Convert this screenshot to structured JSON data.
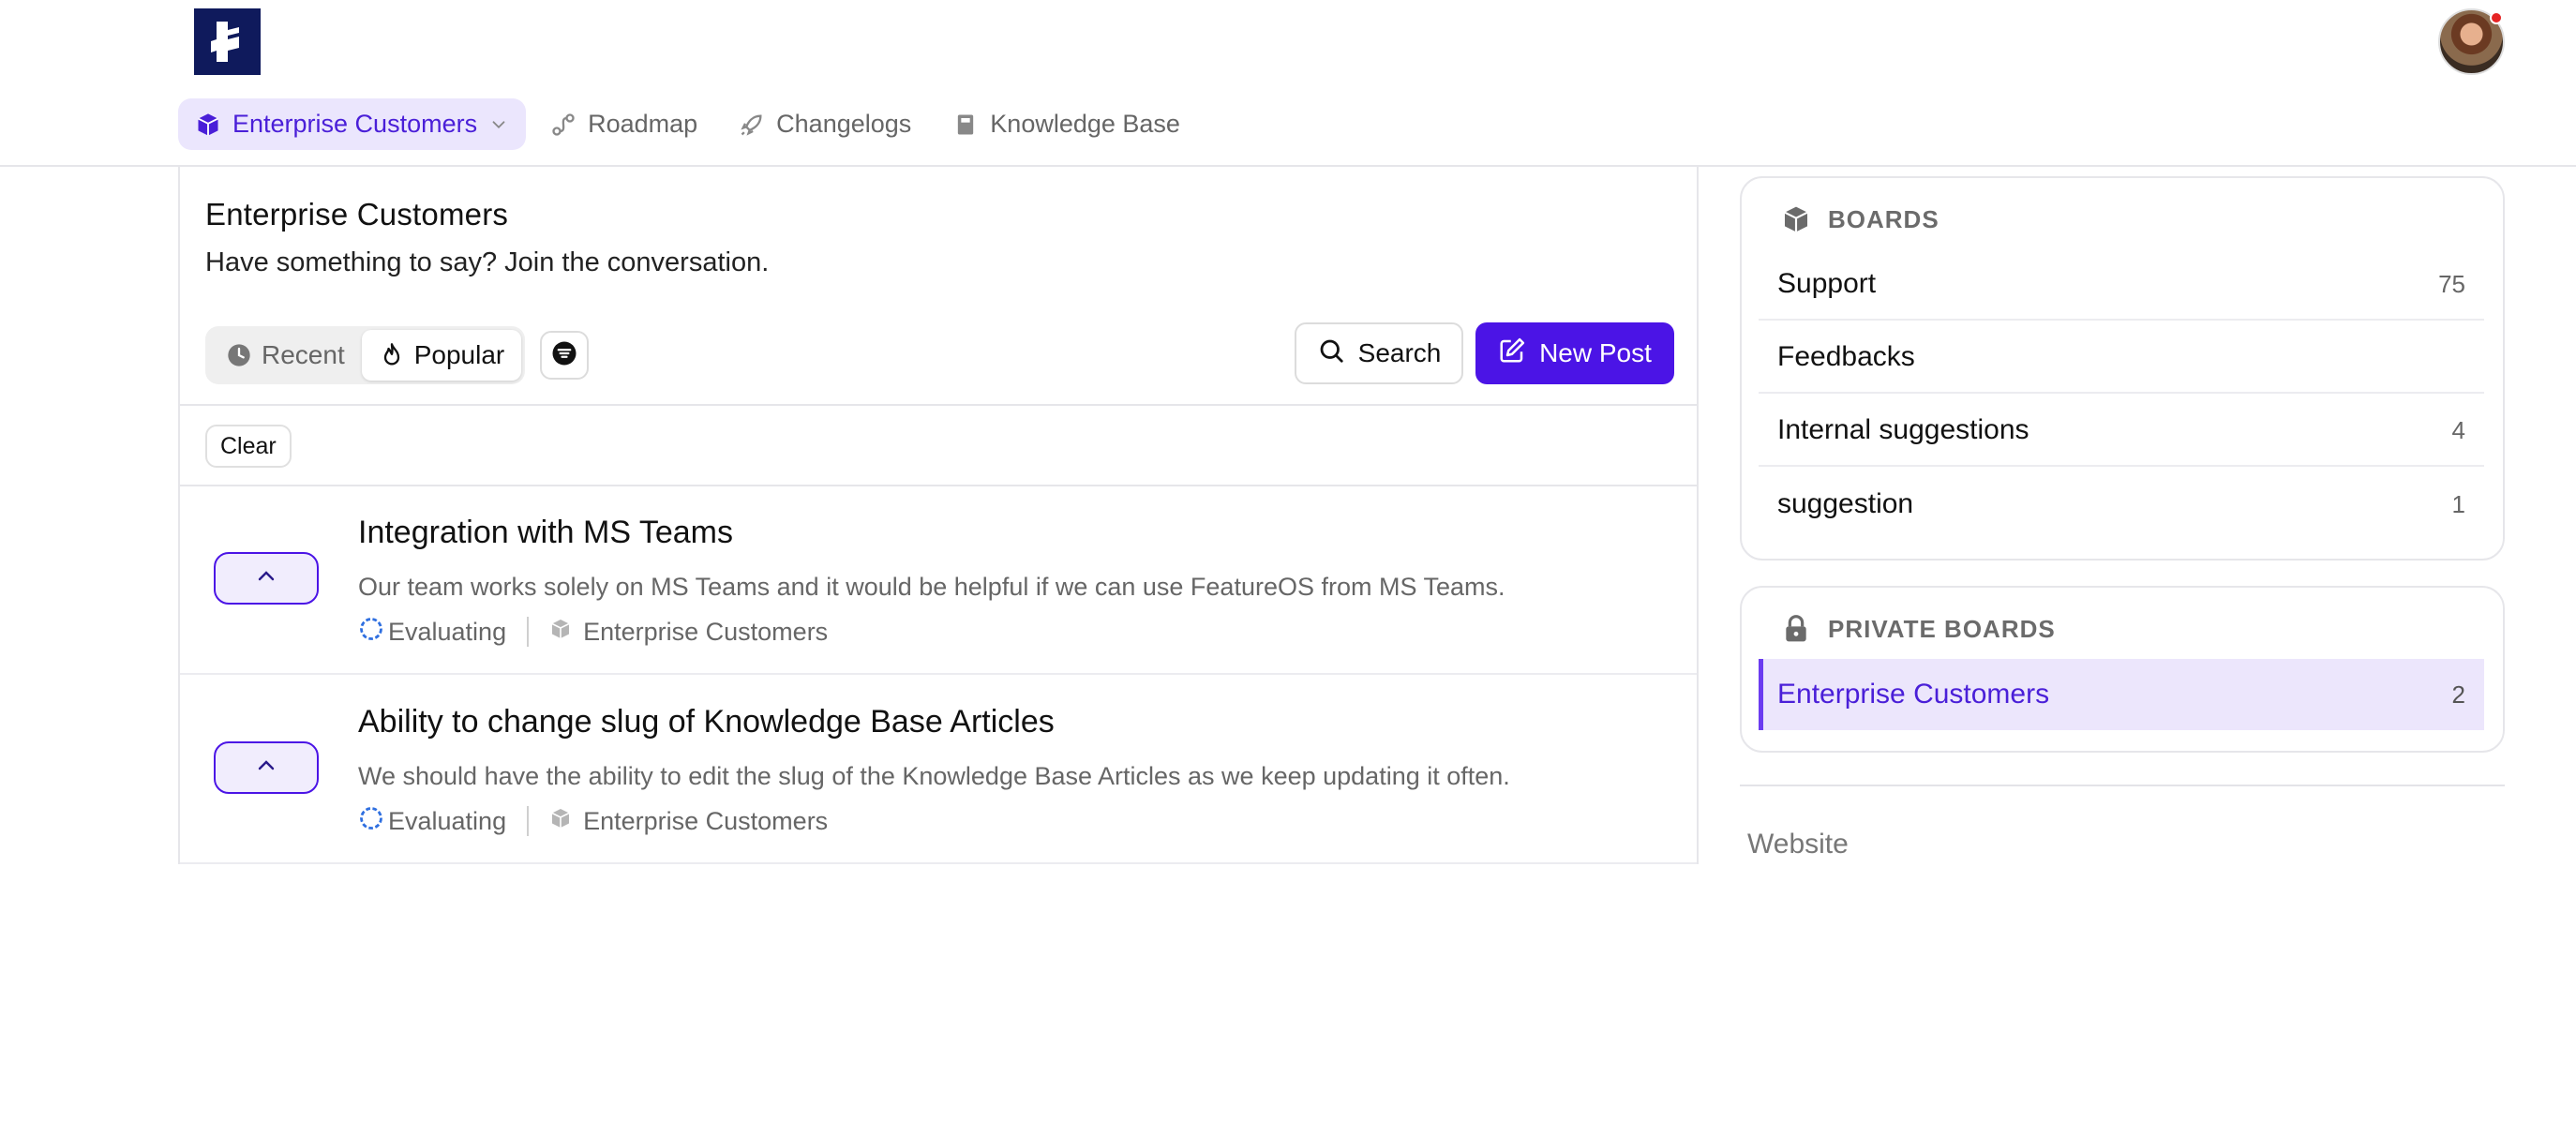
{
  "header": {
    "nav": [
      {
        "label": "Enterprise Customers",
        "icon": "box-icon",
        "active": true
      },
      {
        "label": "Roadmap",
        "icon": "roadmap-icon"
      },
      {
        "label": "Changelogs",
        "icon": "rocket-icon"
      },
      {
        "label": "Knowledge Base",
        "icon": "book-icon"
      }
    ]
  },
  "board": {
    "title": "Enterprise Customers",
    "subtitle": "Have something to say? Join the conversation.",
    "sort": {
      "recent": "Recent",
      "popular": "Popular",
      "selected": "Popular"
    },
    "search_label": "Search",
    "new_post_label": "New Post",
    "clear_label": "Clear"
  },
  "posts": [
    {
      "title": "Integration with MS Teams",
      "description": "Our team works solely on MS Teams and it would be helpful if we can use FeatureOS from MS Teams.",
      "status": "Evaluating",
      "board": "Enterprise Customers"
    },
    {
      "title": "Ability to change slug of Knowledge Base Articles",
      "description": "We should have the ability to edit the slug of the Knowledge Base Articles as we keep updating it often.",
      "status": "Evaluating",
      "board": "Enterprise Customers"
    }
  ],
  "sidebar": {
    "boards_heading": "BOARDS",
    "boards": [
      {
        "name": "Support",
        "count": "75"
      },
      {
        "name": "Feedbacks",
        "count": ""
      },
      {
        "name": "Internal suggestions",
        "count": "4"
      },
      {
        "name": "suggestion",
        "count": "1"
      }
    ],
    "private_heading": "PRIVATE BOARDS",
    "private_boards": [
      {
        "name": "Enterprise Customers",
        "count": "2",
        "selected": true
      }
    ],
    "website_label": "Website"
  },
  "colors": {
    "accent": "#4b14e6",
    "accent_light": "#ebe6fd",
    "logo_bg": "#0f1a5c",
    "notification": "#e52424",
    "status_evaluating": "#2f6fe0"
  }
}
